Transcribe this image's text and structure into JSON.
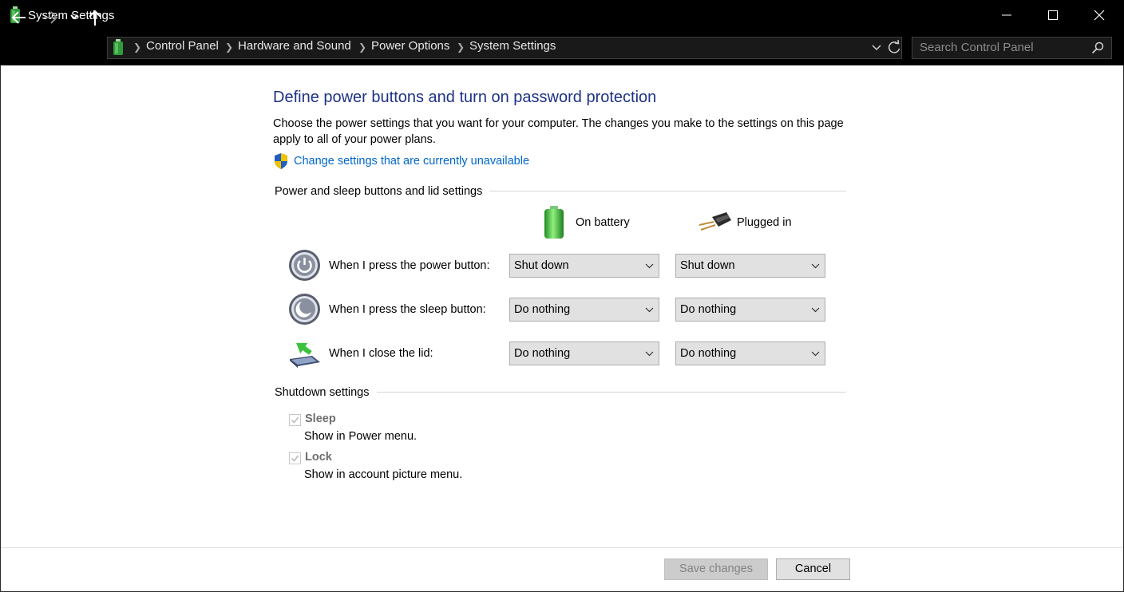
{
  "window": {
    "title": "System Settings"
  },
  "addressbar": {
    "breadcrumbs": [
      "Control Panel",
      "Hardware and Sound",
      "Power Options",
      "System Settings"
    ],
    "search_placeholder": "Search Control Panel"
  },
  "main": {
    "title": "Define power buttons and turn on password protection",
    "description": "Choose the power settings that you want for your computer. The changes you make to the settings on this page apply to all of your power plans.",
    "change_link": "Change settings that are currently unavailable",
    "power_group": {
      "label": "Power and sleep buttons and lid settings",
      "columns": [
        "On battery",
        "Plugged in"
      ],
      "rows": [
        {
          "label": "When I press the power button:",
          "on_battery": "Shut down",
          "plugged_in": "Shut down",
          "icon": "power-button-icon"
        },
        {
          "label": "When I press the sleep button:",
          "on_battery": "Do nothing",
          "plugged_in": "Do nothing",
          "icon": "sleep-button-icon"
        },
        {
          "label": "When I close the lid:",
          "on_battery": "Do nothing",
          "plugged_in": "Do nothing",
          "icon": "laptop-lid-icon"
        }
      ]
    },
    "shutdown_group": {
      "label": "Shutdown settings",
      "items": [
        {
          "title": "Sleep",
          "description": "Show in Power menu.",
          "checked": true,
          "disabled": true
        },
        {
          "title": "Lock",
          "description": "Show in account picture menu.",
          "checked": true,
          "disabled": true
        }
      ]
    }
  },
  "footer": {
    "save_label": "Save changes",
    "cancel_label": "Cancel"
  },
  "colors": {
    "title_blue": "#1e3287",
    "link_blue": "#0066cc",
    "chrome": "#000000"
  }
}
